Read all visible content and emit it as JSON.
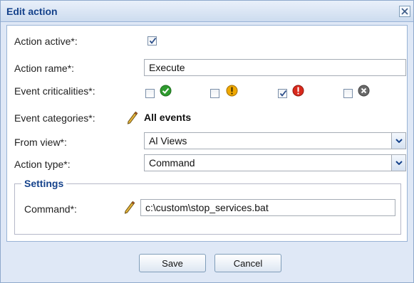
{
  "dialog": {
    "title": "Edit action",
    "close_icon": "close-icon"
  },
  "form": {
    "action_active": {
      "label": "Action active*:",
      "checked": true
    },
    "action_name": {
      "label": "Action rame*:",
      "value": "Execute"
    },
    "event_criticalities": {
      "label": "Event criticalities*:",
      "items": [
        {
          "icon": "ok-icon",
          "checked": false,
          "color": "#2e9b2e"
        },
        {
          "icon": "warning-icon",
          "checked": false,
          "color": "#f0a800"
        },
        {
          "icon": "error-icon",
          "checked": true,
          "color": "#d9291c"
        },
        {
          "icon": "cancel-icon",
          "checked": false,
          "color": "#6a6a6a"
        }
      ]
    },
    "event_categories": {
      "label": "Event categories*:",
      "value": "All events",
      "icon": "pencil-icon"
    },
    "from_view": {
      "label": "From view*:",
      "value": "Al Views"
    },
    "action_type": {
      "label": "Action type*:",
      "value": "Command"
    }
  },
  "settings": {
    "legend": "Settings",
    "command": {
      "label": "Command*:",
      "value": "c:\\custom\\stop_services.bat",
      "icon": "pencil-icon"
    }
  },
  "buttons": {
    "save": "Save",
    "cancel": "Cancel"
  },
  "colors": {
    "title_text": "#15428b",
    "dialog_bg": "#dfe8f6",
    "border": "#99b3d6"
  }
}
